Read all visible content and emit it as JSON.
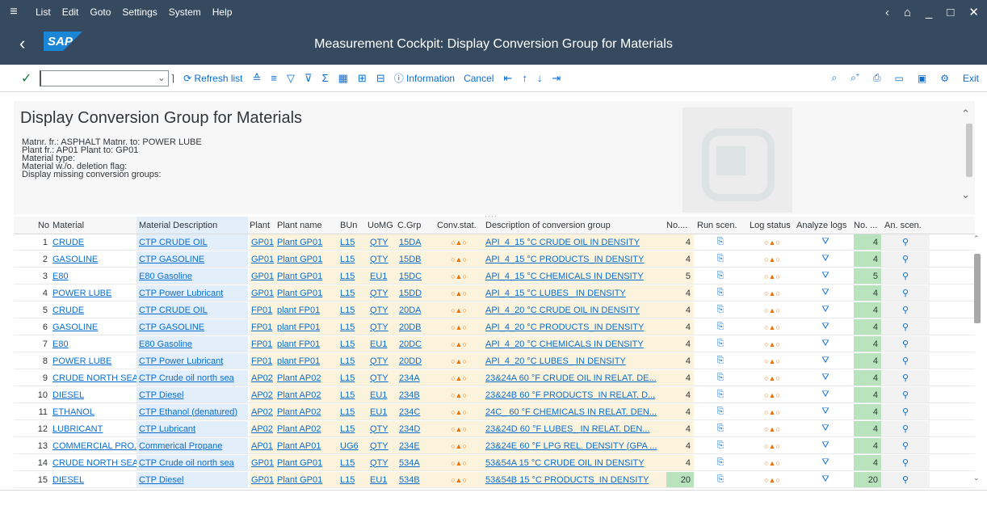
{
  "menu": {
    "items": [
      "List",
      "Edit",
      "Goto",
      "Settings",
      "System",
      "Help"
    ],
    "right_icons": [
      "previous-icon",
      "unlock-icon",
      "minimize-icon",
      "maximize-icon",
      "close-icon"
    ]
  },
  "window": {
    "title": "Measurement Cockpit: Display Conversion Group for Materials",
    "logo": "SAP"
  },
  "toolbar": {
    "refresh_label": "Refresh list",
    "information_label": "Information",
    "cancel_label": "Cancel",
    "exit_label": "Exit"
  },
  "header": {
    "title": "Display Conversion Group for Materials",
    "criteria": [
      "Matnr. fr.: ASPHALT Matnr. to: POWER LUBE",
      "Plant fr.: AP01 Plant to: GP01",
      "Material type:",
      "Material w./o. deletion flag:",
      "Display missing conversion groups:"
    ]
  },
  "grid": {
    "columns": [
      "No",
      "Material",
      "Material Description",
      "Plant",
      "Plant name",
      "BUn",
      "UoMG",
      "C.Grp",
      "Conv.stat.",
      "Description of conversion group",
      "No....",
      "Run scen.",
      "Log status",
      "Analyze logs",
      "No. ...",
      "An. scen."
    ],
    "rows": [
      {
        "no": "1",
        "material": "CRUDE",
        "desc": "CTP CRUDE OIL",
        "plant": "GP01",
        "pname": "Plant GP01",
        "bun": "L15",
        "uomg": "QTY",
        "cgrp": "15DA",
        "stat": "○▲○",
        "cgdesc": "API_4_15 °C CRUDE OIL IN DENSITY",
        "n1": "4",
        "log": "○▲○",
        "n2": "4"
      },
      {
        "no": "2",
        "material": "GASOLINE",
        "desc": "CTP GASOLINE",
        "plant": "GP01",
        "pname": "Plant GP01",
        "bun": "L15",
        "uomg": "QTY",
        "cgrp": "15DB",
        "stat": "○▲○",
        "cgdesc": "API_4_15 °C PRODUCTS_IN DENSITY",
        "n1": "4",
        "log": "○▲○",
        "n2": "4"
      },
      {
        "no": "3",
        "material": "E80",
        "desc": "E80 Gasoline",
        "plant": "GP01",
        "pname": "Plant GP01",
        "bun": "L15",
        "uomg": "EU1",
        "cgrp": "15DC",
        "stat": "○▲○",
        "cgdesc": "API_4_15 °C CHEMICALS IN DENSITY",
        "n1": "5",
        "log": "○▲○",
        "n2": "5"
      },
      {
        "no": "4",
        "material": "POWER LUBE",
        "desc": "CTP Power Lubricant",
        "plant": "GP01",
        "pname": "Plant GP01",
        "bun": "L15",
        "uomg": "QTY",
        "cgrp": "15DD",
        "stat": "○▲○",
        "cgdesc": "API_4_15 °C LUBES_ IN DENSITY",
        "n1": "4",
        "log": "○▲○",
        "n2": "4"
      },
      {
        "no": "5",
        "material": "CRUDE",
        "desc": "CTP CRUDE OIL",
        "plant": "FP01",
        "pname": "plant FP01",
        "bun": "L15",
        "uomg": "QTY",
        "cgrp": "20DA",
        "stat": "○▲○",
        "cgdesc": "API_4_20 °C CRUDE OIL IN DENSITY",
        "n1": "4",
        "log": "○▲○",
        "n2": "4"
      },
      {
        "no": "6",
        "material": "GASOLINE",
        "desc": "CTP GASOLINE",
        "plant": "FP01",
        "pname": "plant FP01",
        "bun": "L15",
        "uomg": "QTY",
        "cgrp": "20DB",
        "stat": "○▲○",
        "cgdesc": "API_4_20 °C PRODUCTS_IN DENSITY",
        "n1": "4",
        "log": "○▲○",
        "n2": "4"
      },
      {
        "no": "7",
        "material": "E80",
        "desc": "E80 Gasoline",
        "plant": "FP01",
        "pname": "plant FP01",
        "bun": "L15",
        "uomg": "EU1",
        "cgrp": "20DC",
        "stat": "○▲○",
        "cgdesc": "API_4_20 °C CHEMICALS IN DENSITY",
        "n1": "4",
        "log": "○▲○",
        "n2": "4"
      },
      {
        "no": "8",
        "material": "POWER LUBE",
        "desc": "CTP Power Lubricant",
        "plant": "FP01",
        "pname": "plant FP01",
        "bun": "L15",
        "uomg": "QTY",
        "cgrp": "20DD",
        "stat": "○▲○",
        "cgdesc": "API_4_20 °C LUBES_ IN DENSITY",
        "n1": "4",
        "log": "○▲○",
        "n2": "4"
      },
      {
        "no": "9",
        "material": "CRUDE NORTH SEA",
        "desc": "CTP Crude oil north sea",
        "plant": "AP02",
        "pname": "Plant AP02",
        "bun": "L15",
        "uomg": "QTY",
        "cgrp": "234A",
        "stat": "○▲○",
        "cgdesc": "23&24A 60 °F CRUDE OIL IN RELAT. DE...",
        "n1": "4",
        "log": "○▲○",
        "n2": "4"
      },
      {
        "no": "10",
        "material": "DIESEL",
        "desc": "CTP Diesel",
        "plant": "AP02",
        "pname": "Plant AP02",
        "bun": "L15",
        "uomg": "EU1",
        "cgrp": "234B",
        "stat": "○▲○",
        "cgdesc": "23&24B 60 °F PRODUCTS_IN RELAT. D...",
        "n1": "4",
        "log": "○▲○",
        "n2": "4"
      },
      {
        "no": "11",
        "material": "ETHANOL",
        "desc": "CTP Ethanol (denatured)",
        "plant": "AP02",
        "pname": "Plant AP02",
        "bun": "L15",
        "uomg": "EU1",
        "cgrp": "234C",
        "stat": "○▲○",
        "cgdesc": "24C_ 60 °F CHEMICALS IN RELAT. DEN...",
        "n1": "4",
        "log": "○▲○",
        "n2": "4"
      },
      {
        "no": "12",
        "material": "LUBRICANT",
        "desc": "CTP Lubricant",
        "plant": "AP02",
        "pname": "Plant AP02",
        "bun": "L15",
        "uomg": "QTY",
        "cgrp": "234D",
        "stat": "○▲○",
        "cgdesc": "23&24D 60 °F LUBES_ IN RELAT. DEN...",
        "n1": "4",
        "log": "○▲○",
        "n2": "4"
      },
      {
        "no": "13",
        "material": "COMMERCIAL PRO...",
        "desc": "Commerical Propane",
        "plant": "AP01",
        "pname": "Plant AP01",
        "bun": "UG6",
        "uomg": "QTY",
        "cgrp": "234E",
        "stat": "○▲○",
        "cgdesc": "23&24E 60 °F LPG REL. DENSITY (GPA ...",
        "n1": "4",
        "log": "○▲○",
        "n2": "4"
      },
      {
        "no": "14",
        "material": "CRUDE NORTH SEA",
        "desc": "CTP Crude oil north sea",
        "plant": "GP01",
        "pname": "Plant GP01",
        "bun": "L15",
        "uomg": "QTY",
        "cgrp": "534A",
        "stat": "○▲○",
        "cgdesc": "53&54A 15 °C CRUDE OIL IN DENSITY",
        "n1": "4",
        "log": "○▲○",
        "n2": "4"
      },
      {
        "no": "15",
        "material": "DIESEL",
        "desc": "CTP Diesel",
        "plant": "GP01",
        "pname": "Plant GP01",
        "bun": "L15",
        "uomg": "EU1",
        "cgrp": "534B",
        "stat": "○▲○",
        "cgdesc": "53&54B 15 °C PRODUCTS_IN DENSITY",
        "n1": "20",
        "log": "○▲○",
        "n2": "20"
      }
    ]
  },
  "colors": {
    "shell": "#354a5f",
    "link": "#0a6ed1",
    "key_col": "#e2eefa",
    "value_col": "#fcf3dc",
    "count_col": "#b8e3bc"
  }
}
